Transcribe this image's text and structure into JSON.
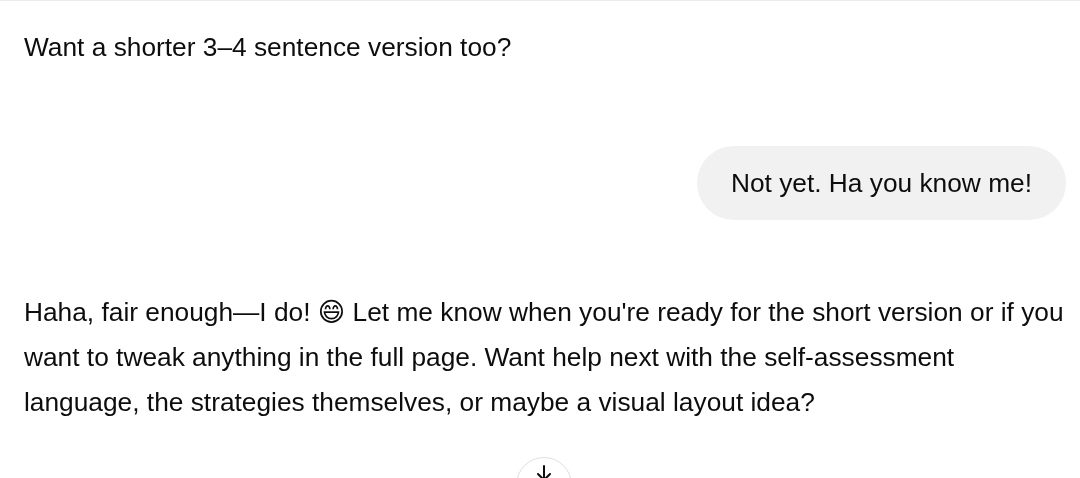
{
  "messages": [
    {
      "kind": "assistant",
      "text": "Want a shorter 3–4 sentence version too?"
    },
    {
      "kind": "user",
      "text": "Not yet. Ha you know me!"
    },
    {
      "kind": "assistant",
      "text": "Haha, fair enough—I do! 😄 Let me know when you're ready for the short version or if you want to tweak anything in the full page. Want help next with the self-assessment language, the strategies themselves, or maybe a visual layout idea?"
    }
  ]
}
